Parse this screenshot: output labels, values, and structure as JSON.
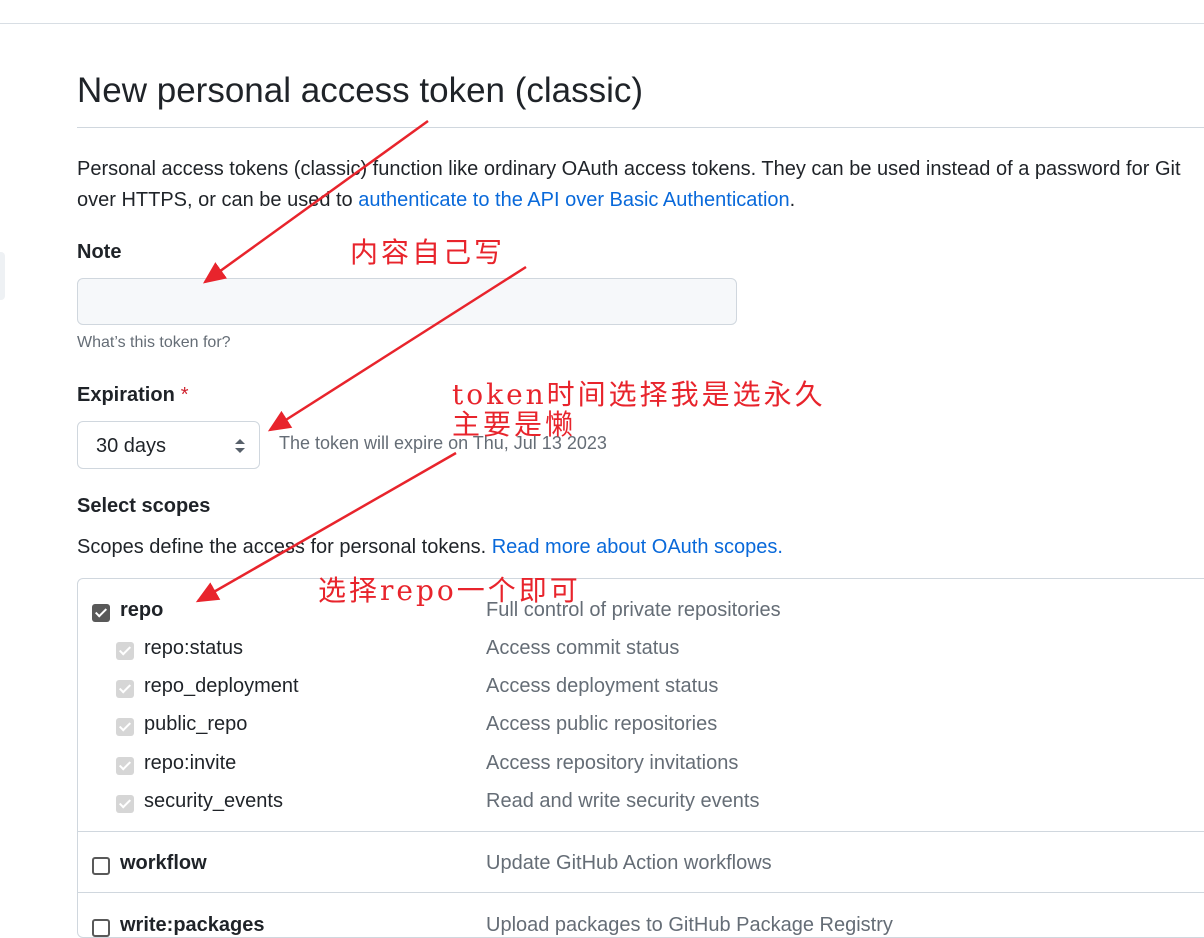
{
  "page": {
    "title": "New personal access token (classic)",
    "intro_line_1": "Personal access tokens (classic) function like ordinary OAuth access tokens. They can be used instead of a password for Git",
    "intro_line_2_prefix": "over HTTPS, or can be used to ",
    "intro_link": "authenticate to the API over Basic Authentication",
    "intro_suffix": "."
  },
  "note": {
    "label": "Note",
    "value": "",
    "hint": "What’s this token for?"
  },
  "expiration": {
    "label": "Expiration",
    "required_mark": "*",
    "selected": "30 days",
    "expire_text": "The token will expire on Thu, Jul 13 2023"
  },
  "scopes": {
    "label": "Select scopes",
    "description": "Scopes define the access for personal tokens. ",
    "read_more": "Read more about OAuth scopes.",
    "items": [
      {
        "name": "repo",
        "desc": "Full control of private repositories",
        "state": "checked"
      },
      {
        "name": "repo:status",
        "desc": "Access commit status",
        "state": "checked-disabled"
      },
      {
        "name": "repo_deployment",
        "desc": "Access deployment status",
        "state": "checked-disabled"
      },
      {
        "name": "public_repo",
        "desc": "Access public repositories",
        "state": "checked-disabled"
      },
      {
        "name": "repo:invite",
        "desc": "Access repository invitations",
        "state": "checked-disabled"
      },
      {
        "name": "security_events",
        "desc": "Read and write security events",
        "state": "checked-disabled"
      },
      {
        "name": "workflow",
        "desc": "Update GitHub Action workflows",
        "state": "unchecked"
      },
      {
        "name": "write:packages",
        "desc": "Upload packages to GitHub Package Registry",
        "state": "unchecked"
      }
    ]
  },
  "annotations": {
    "note_hint": "内容自己写",
    "expiration_line1": "token时间选择我是选永久",
    "expiration_line2": "主要是懒",
    "scope_hint": "选择repo一个即可",
    "color": "#e8242c"
  }
}
